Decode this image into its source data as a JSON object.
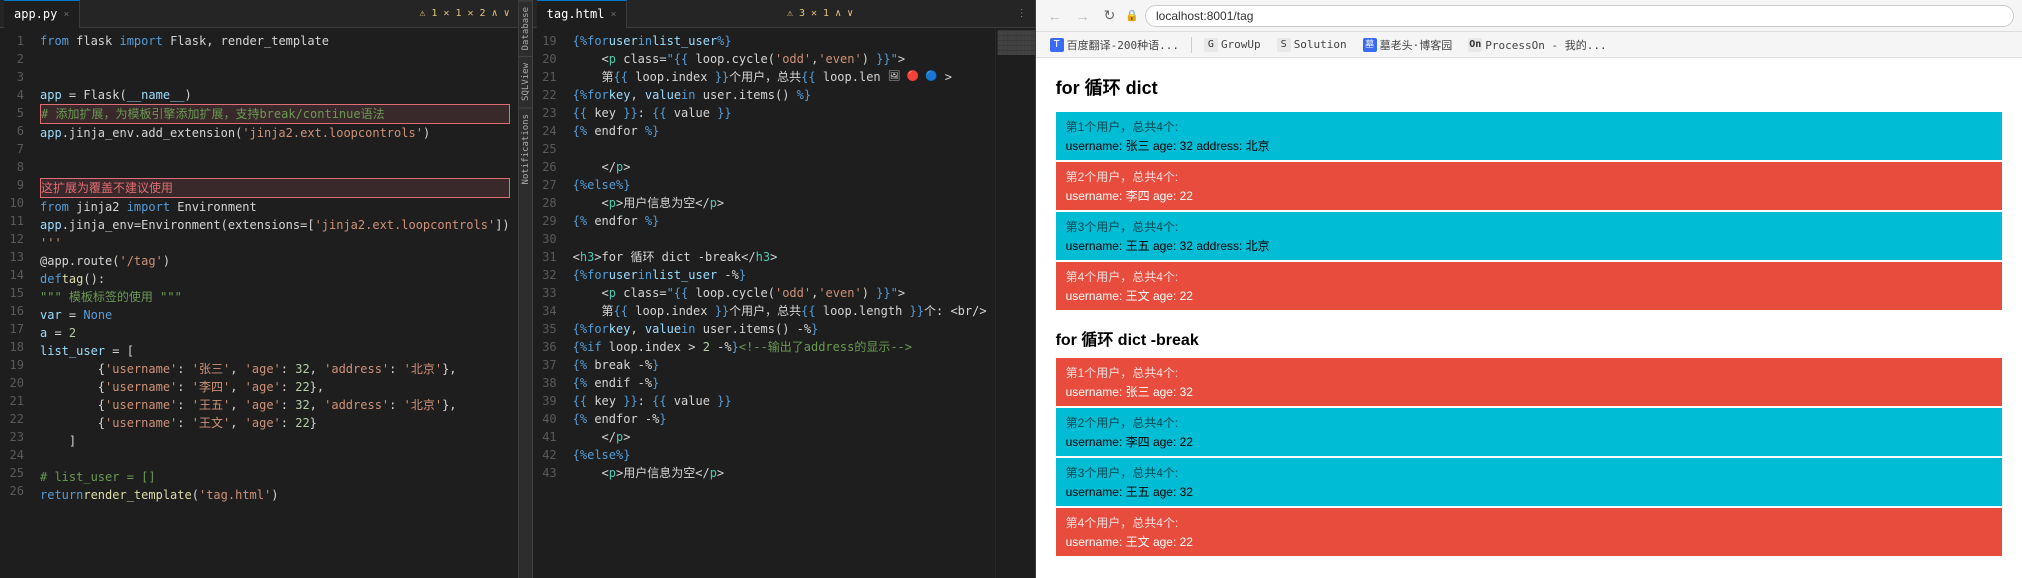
{
  "tabs": {
    "left": {
      "filename": "app.py",
      "active": true
    },
    "right": {
      "filename": "tag.html",
      "active": true
    }
  },
  "left_editor": {
    "lines": [
      {
        "num": 1,
        "code": "from flask import Flask, render_template",
        "type": "normal"
      },
      {
        "num": 2,
        "code": "",
        "type": "normal"
      },
      {
        "num": 3,
        "code": "",
        "type": "normal"
      },
      {
        "num": 4,
        "code": "app = Flask(__name__)",
        "type": "normal"
      },
      {
        "num": 5,
        "code": "# 添加扩展，为模板引擎添加扩展，支持break/continue语法",
        "type": "highlighted"
      },
      {
        "num": 6,
        "code": "app.jinja_env.add_extension('jinja2.ext.loopcontrols')",
        "type": "normal"
      },
      {
        "num": 7,
        "code": "",
        "type": "normal"
      },
      {
        "num": 8,
        "code": "",
        "type": "normal"
      },
      {
        "num": 9,
        "code": "这扩展为覆盖不建议使用",
        "type": "highlighted"
      },
      {
        "num": 10,
        "code": "from jinja2 import Environment",
        "type": "normal"
      },
      {
        "num": 11,
        "code": "app.jinja_env=Environment(extensions=['jinja2.ext.loopcontrols'])",
        "type": "normal"
      },
      {
        "num": 12,
        "code": "'''",
        "type": "normal"
      },
      {
        "num": 13,
        "code": "@app.route('/tag')",
        "type": "normal"
      },
      {
        "num": 14,
        "code": "def tag():",
        "type": "normal"
      },
      {
        "num": 15,
        "code": "    \"\"\" 模板标签的使用 \"\"\"",
        "type": "normal"
      },
      {
        "num": 16,
        "code": "    var = None",
        "type": "normal"
      },
      {
        "num": 17,
        "code": "    a = 2",
        "type": "normal"
      },
      {
        "num": 18,
        "code": "    list_user = [",
        "type": "normal"
      },
      {
        "num": 19,
        "code": "        {'username': '张三', 'age': 32, 'address': '北京'},",
        "type": "normal"
      },
      {
        "num": 20,
        "code": "        {'username': '李四', 'age': 22},",
        "type": "normal"
      },
      {
        "num": 21,
        "code": "        {'username': '王五', 'age': 32, 'address': '北京'},",
        "type": "normal"
      },
      {
        "num": 22,
        "code": "        {'username': '王文', 'age': 22}",
        "type": "normal"
      },
      {
        "num": 23,
        "code": "    ]",
        "type": "normal"
      },
      {
        "num": 24,
        "code": "",
        "type": "normal"
      },
      {
        "num": 25,
        "code": "    # list_user = []",
        "type": "normal"
      },
      {
        "num": 26,
        "code": "    return render_template('tag.html')",
        "type": "normal"
      }
    ]
  },
  "right_editor": {
    "lines": [
      {
        "num": 19,
        "code": "{% for user in list_user %}"
      },
      {
        "num": 20,
        "code": "    <p class=\"{{ loop.cycle('odd','even') }}\">"
      },
      {
        "num": 21,
        "code": "    第{{ loop.index }}个用户，总共{{ loop.len 🖼 🔴 🔵 >"
      },
      {
        "num": 22,
        "code": "    {% for key, value in user.items() %}"
      },
      {
        "num": 23,
        "code": "        {{ key }}: {{ value }}"
      },
      {
        "num": 24,
        "code": "    {% endfor %}"
      },
      {
        "num": 25,
        "code": ""
      },
      {
        "num": 26,
        "code": "    </p>"
      },
      {
        "num": 27,
        "code": "{% else %}"
      },
      {
        "num": 28,
        "code": "    <p>用户信息为空</p>"
      },
      {
        "num": 29,
        "code": "{% endfor %}"
      },
      {
        "num": 30,
        "code": ""
      },
      {
        "num": 31,
        "code": "<h3>for 循环 dict -break</h3>"
      },
      {
        "num": 32,
        "code": "{% for user in list_user -%}"
      },
      {
        "num": 33,
        "code": "    <p class=\"{{ loop.cycle('odd','even') }}\">"
      },
      {
        "num": 34,
        "code": "    第{{ loop.index }}个用户，总共{{ loop.length }}个: <br/>"
      },
      {
        "num": 35,
        "code": "    {% for key, value in user.items() -%}"
      },
      {
        "num": 36,
        "code": "        {% if loop.index > 2 -%}    <!--输出了address的显示-->"
      },
      {
        "num": 37,
        "code": "            {% break -%}"
      },
      {
        "num": 38,
        "code": "        {% endif -%}"
      },
      {
        "num": 39,
        "code": "        {{ key }}: {{ value }}"
      },
      {
        "num": 40,
        "code": "    {% endfor -%}"
      },
      {
        "num": 41,
        "code": "    </p>"
      },
      {
        "num": 42,
        "code": "{% else %}"
      },
      {
        "num": 43,
        "code": "    <p>用户信息为空</p>"
      }
    ]
  },
  "side_panels": [
    "Database",
    "SQlView",
    "Notifications"
  ],
  "browser": {
    "url": "localhost:8001/tag",
    "back_enabled": false,
    "forward_enabled": false,
    "bookmarks": [
      {
        "label": "百度翻译-200种语...",
        "icon": "T"
      },
      {
        "label": "GrowUp",
        "icon": "G"
      },
      {
        "label": "Solution",
        "icon": "S"
      },
      {
        "label": "墓老头·博客园",
        "icon": "墓"
      },
      {
        "label": "ProcessOn - 我的...",
        "icon": "P"
      }
    ],
    "sections": [
      {
        "title": "for 循环 dict",
        "users": [
          {
            "num": "第1个用户，总共4个:",
            "info": "username: 张三 age: 32 address: 北京",
            "style": "cyan"
          },
          {
            "num": "第2个用户，总共4个:",
            "info": "username: 李四 age: 22",
            "style": "red"
          },
          {
            "num": "第3个用户，总共4个:",
            "info": "username: 王五 age: 32 address: 北京",
            "style": "cyan"
          },
          {
            "num": "第4个用户，总共4个:",
            "info": "username: 王文 age: 22",
            "style": "red"
          }
        ]
      },
      {
        "title": "for 循环 dict -break",
        "users": [
          {
            "num": "第1个用户，总共4个:",
            "info": "username: 张三 age: 32",
            "style": "red"
          },
          {
            "num": "第2个用户，总共4个:",
            "info": "username: 李四 age: 22",
            "style": "cyan"
          },
          {
            "num": "第3个用户，总共4个:",
            "info": "username: 王五 age: 32",
            "style": "cyan"
          },
          {
            "num": "第4个用户，总共4个:",
            "info": "username: 王文 age: 22",
            "style": "red"
          }
        ]
      }
    ]
  }
}
